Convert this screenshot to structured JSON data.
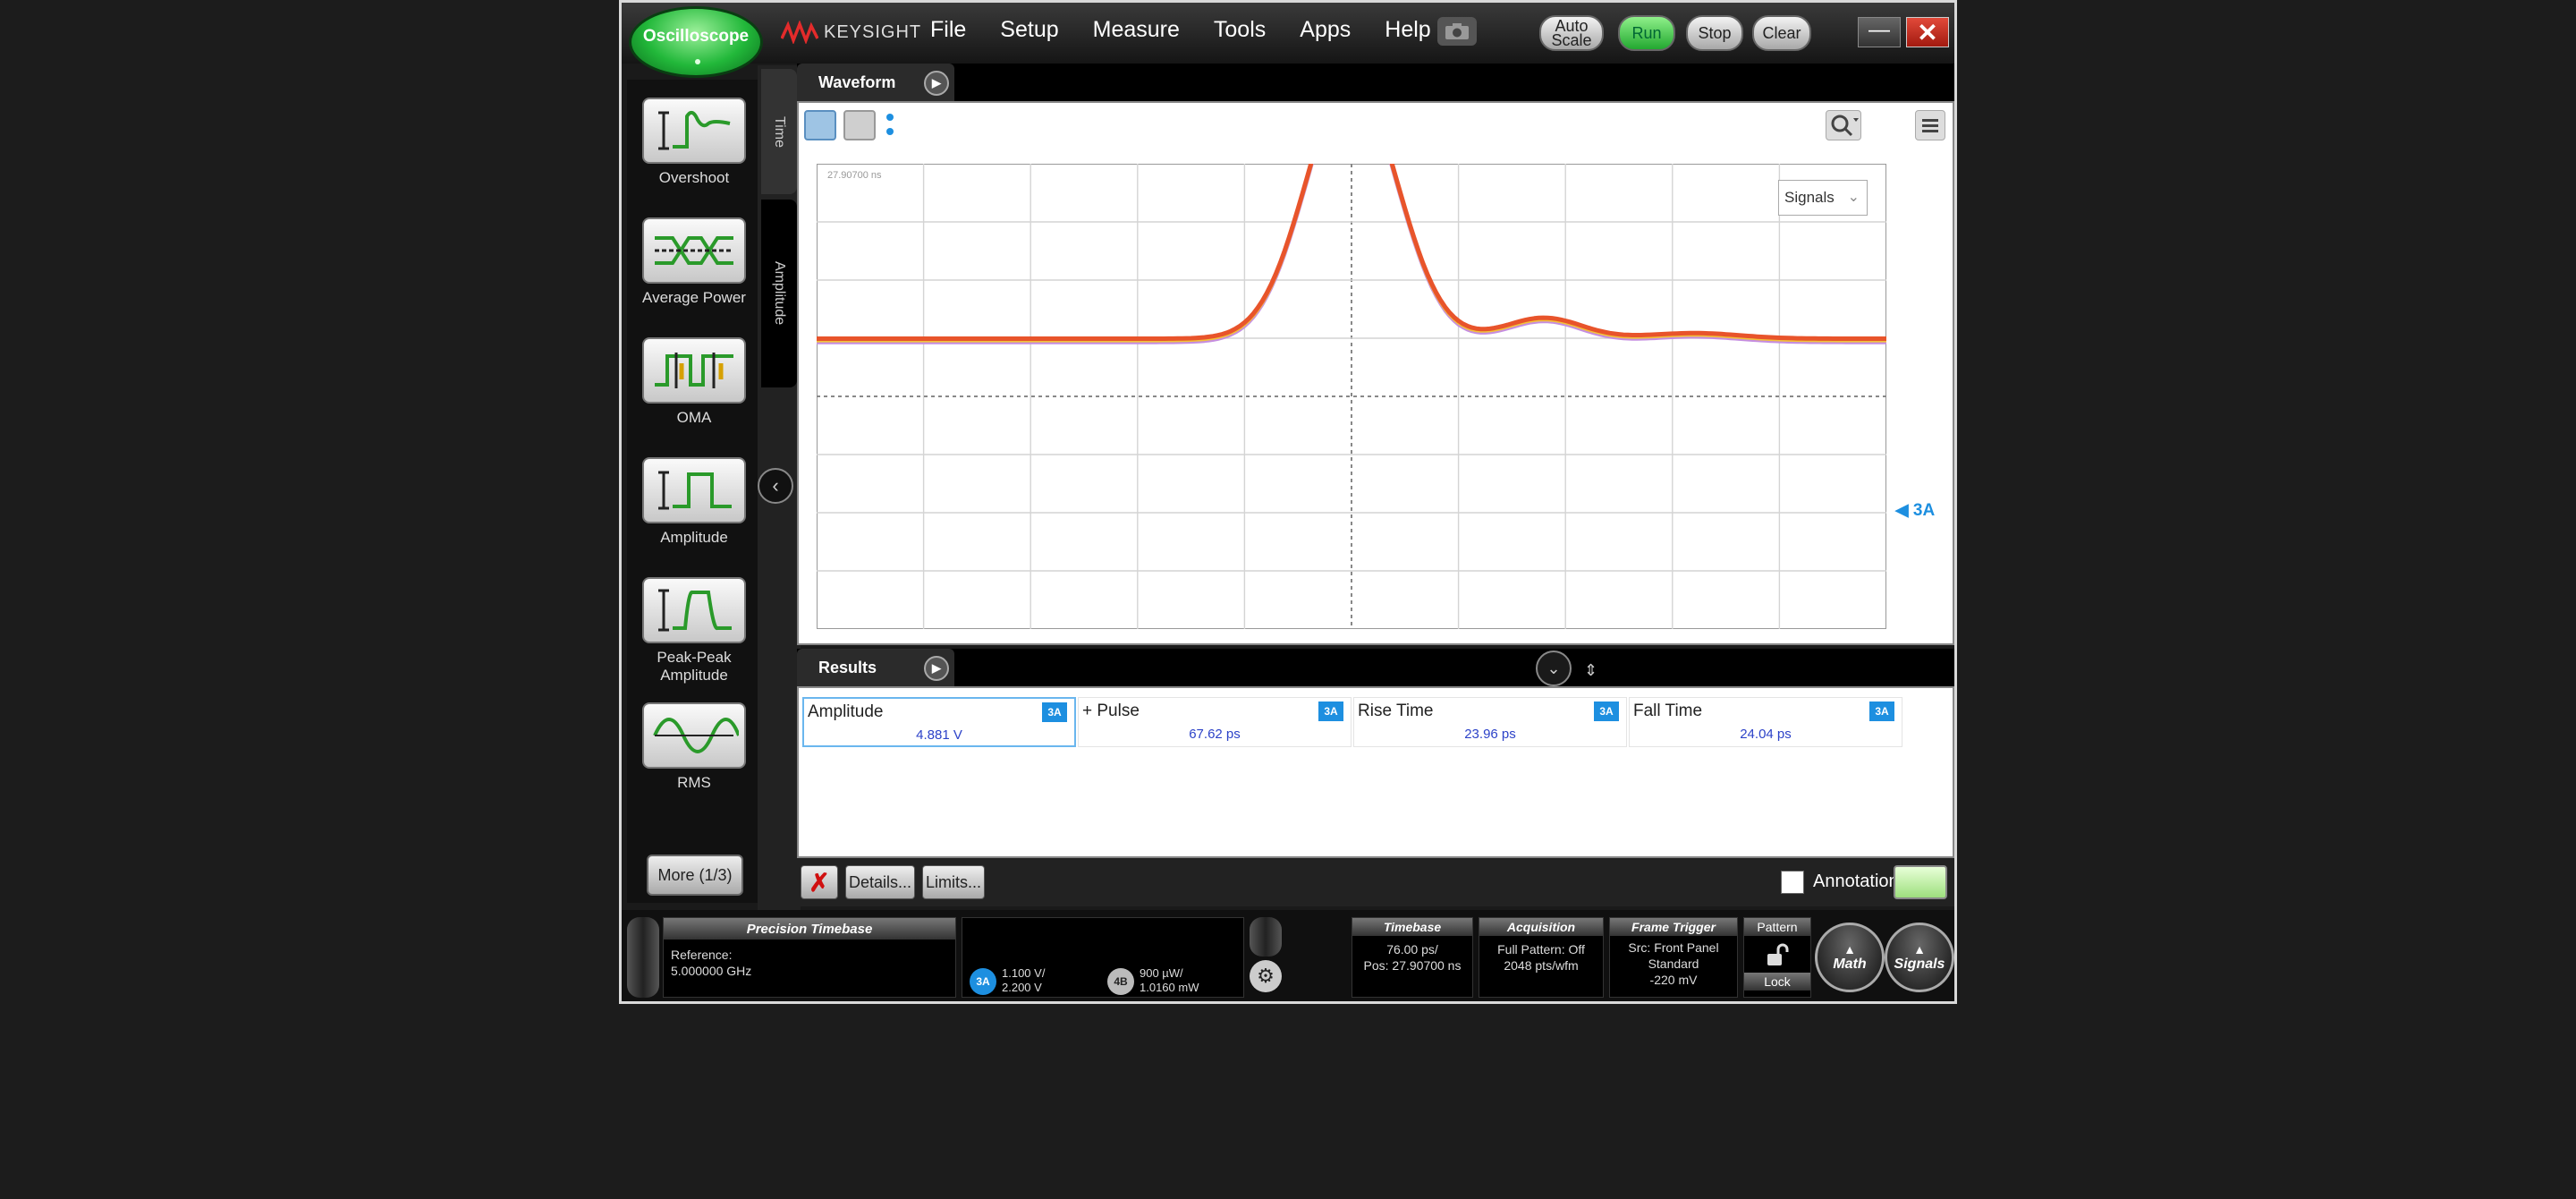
{
  "topbar": {
    "oscilloscope_label": "Oscilloscope",
    "brand": "KEYSIGHT",
    "menu": [
      "File",
      "Setup",
      "Measure",
      "Tools",
      "Apps",
      "Help"
    ],
    "buttons": {
      "auto_scale": "Auto Scale",
      "run": "Run",
      "stop": "Stop",
      "clear": "Clear"
    },
    "window": {
      "minimize": "—",
      "close": "✕"
    }
  },
  "sidebar": {
    "measurements": [
      {
        "label": "Overshoot",
        "icon": "overshoot-icon"
      },
      {
        "label": "Average Power",
        "icon": "average-power-icon"
      },
      {
        "label": "OMA",
        "icon": "oma-icon"
      },
      {
        "label": "Amplitude",
        "icon": "amplitude-icon"
      },
      {
        "label": "Peak-Peak Amplitude",
        "icon": "peak-peak-amplitude-icon"
      },
      {
        "label": "RMS",
        "icon": "rms-icon"
      }
    ],
    "more": "More (1/3)"
  },
  "vertical_tabs": {
    "time": "Time",
    "amplitude": "Amplitude"
  },
  "waveform": {
    "tab": "Waveform",
    "signals_dropdown": "Signals",
    "marker": "3A",
    "timestamp": "27.90700 ns",
    "colors": {
      "trace_primary": "#e8542b",
      "trace_secondary": "#f2c23a",
      "trace_tertiary": "#c58de0",
      "marker": "#1d8fe0"
    }
  },
  "results": {
    "tab": "Results",
    "grip": "⇕",
    "items": [
      {
        "name": "Amplitude",
        "source": "3A",
        "value": "4.881 V"
      },
      {
        "name": "+ Pulse",
        "source": "3A",
        "value": "67.62 ps"
      },
      {
        "name": "Rise Time",
        "source": "3A",
        "value": "23.96 ps"
      },
      {
        "name": "Fall Time",
        "source": "3A",
        "value": "24.04 ps"
      }
    ],
    "footer": {
      "delete": "✗",
      "details": "Details...",
      "limits": "Limits...",
      "annotations": "Annotations"
    }
  },
  "statusbar": {
    "precision_timebase": {
      "title": "Precision Timebase",
      "line1": "Reference:",
      "line2": "5.000000 GHz"
    },
    "channels": [
      {
        "id": "3A",
        "line1": "1.100 V/",
        "line2": "2.200 V",
        "color": "#1d8fe0"
      },
      {
        "id": "4B",
        "line1": "900 µW/",
        "line2": "1.0160 mW",
        "color": "#bbbbbb"
      }
    ],
    "timebase": {
      "title": "Timebase",
      "line1": "76.00 ps/",
      "line2": "Pos: 27.90700 ns"
    },
    "acquisition": {
      "title": "Acquisition",
      "line1": "Full Pattern: Off",
      "line2": "2048 pts/wfm"
    },
    "frame_trigger": {
      "title": "Frame Trigger",
      "line1": "Src: Front Panel",
      "line2": "Standard",
      "line3": "-220 mV"
    },
    "pattern": {
      "title": "Pattern",
      "lock": "Lock"
    },
    "math": "Math",
    "signals": "Signals"
  }
}
